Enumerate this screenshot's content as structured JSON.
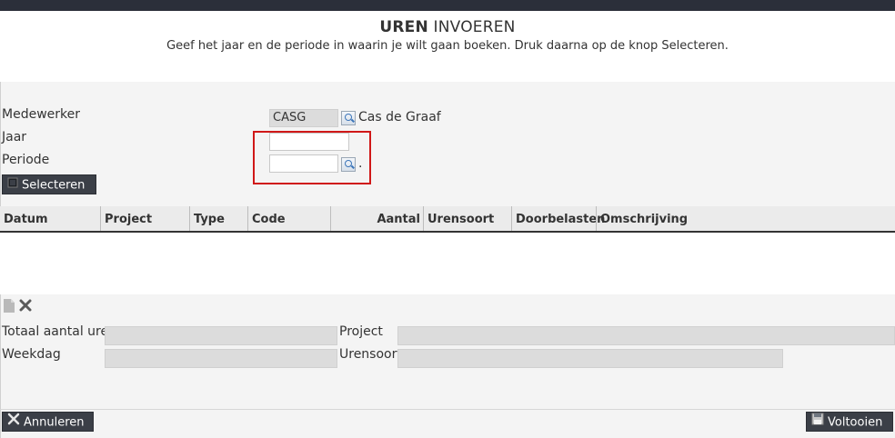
{
  "header": {
    "title_bold": "UREN",
    "title_rest": "INVOEREN",
    "subtitle": "Geef het jaar en de periode in waarin je wilt gaan boeken. Druk daarna op de knop Selecteren."
  },
  "form": {
    "medewerker_label": "Medewerker",
    "medewerker_code": "CASG",
    "medewerker_name": "Cas de Graaf",
    "jaar_label": "Jaar",
    "jaar_value": "",
    "periode_label": "Periode",
    "periode_value": "",
    "periode_suffix": ".",
    "select_button": "Selecteren"
  },
  "grid": {
    "columns": [
      "Datum",
      "Project",
      "Type",
      "Code",
      "Aantal",
      "Urensoort",
      "Doorbelasten",
      "Omschrijving"
    ]
  },
  "details": {
    "totaal_label": "Totaal aantal uren",
    "project_label": "Project",
    "weekdag_label": "Weekdag",
    "urensoort_label": "Urensoort"
  },
  "footer": {
    "cancel_button": "Annuleren",
    "finish_button": "Voltooien"
  }
}
